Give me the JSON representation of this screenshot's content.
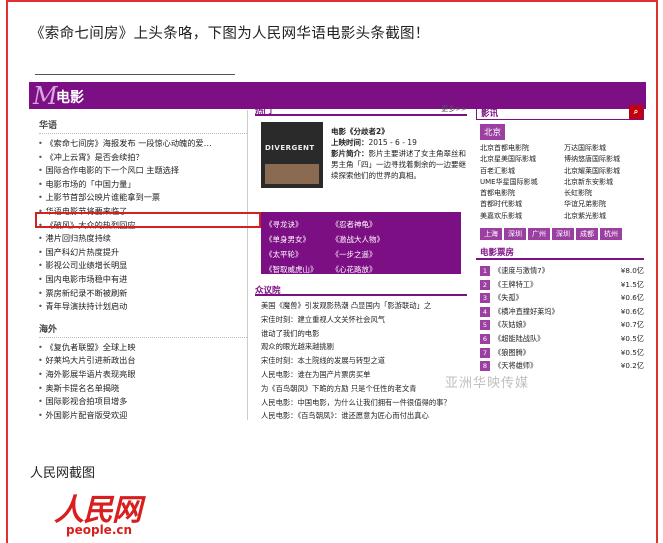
{
  "headline": "《索命七间房》上头条咯，下图为人民网华语电影头条截图！",
  "screenshot": {
    "section_logo_mark": "M",
    "section_title": "电影",
    "left": {
      "chinese_title": "华语",
      "chinese_items": [
        "《索命七间房》海报发布 一段惊心动魄的爱…",
        "《冲上云霄》是否会续拍？",
        "国际合作电影的下一个风口 主题选择",
        "电影市场的「中国力量」",
        "上影节首部公映片谁能拿到一票",
        "华语电影节将要来临了",
        "《破风》大众的热烈回应",
        "港片回归热度持续",
        "国产科幻片热度提升",
        "影视公司业绩增长明显",
        "国内电影市场稳中有进",
        "票房新纪录不断被刷新",
        "青年导演扶持计划启动"
      ],
      "overseas_title": "海外",
      "overseas_items": [
        "《复仇者联盟》全球上映",
        "好莱坞大片引进新政出台",
        "海外影展华语片表现亮眼",
        "奥斯卡提名名单揭晓",
        "国际影视合拍项目增多",
        "外国影片配音版受欢迎"
      ]
    },
    "middle": {
      "hot_label": "热门",
      "more_label": "更多>>",
      "poster_title": "DIVERGENT",
      "movie_title": "电影《分歧者2》",
      "release_label": "上映时间：",
      "release_date": "2015 - 6 - 19",
      "synopsis_label": "影片简介：",
      "synopsis": "影片主要讲述了女主角翠丝和男主角「四」一边寻找着剩余的一边要继续探索他们的世界的真相。",
      "tags": [
        "《寻龙诀》",
        "《忍者神龟》",
        "《单身男女》",
        "《激战大人物》",
        "《太平轮》",
        "《一步之遥》",
        "《智取威虎山》",
        "《心花路放》"
      ],
      "forum_title": "众议院",
      "forum_items": [
        "美国《魔兽》引发观影热潮 凸显国内「影游联动」之",
        "宋佳时刻：建立重视人文关怀社会风气",
        "谁动了我们的电影",
        "观众的眼光越来越挑剔",
        "宋佳时刻：本土院线的发展与转型之道",
        "人民电影：谁在为国产片票房买单",
        "为《百鸟朝凤》下跪的方励 只是个任性的老文青",
        "人民电影：中国电影，为什么让我们拥有一件很值得的事？",
        "人民电影：《百鸟朝凤》：谁还愿意为匠心而付出真心"
      ]
    },
    "right": {
      "header": "影讯",
      "search_icon_glyph": "⌕",
      "city": "北京",
      "cinemas": [
        "北京首都电影院",
        "万达国际影城",
        "北京星美国际影城",
        "博纳悠唐国际影城",
        "百老汇影城",
        "北京耀莱国际影城",
        "UME华星国际影城",
        "北京新东安影城",
        "首都电影院",
        "长虹影院",
        "首都时代影城",
        "华谊兄弟影院",
        "美嘉欢乐影城",
        "北京紫光影城"
      ],
      "cities": [
        "上海",
        "深圳",
        "广州",
        "深圳",
        "成都",
        "杭州"
      ],
      "box_office_title": "电影票房",
      "box_office": [
        {
          "rank": "1",
          "name": "《速度与激情7》",
          "price": "¥8.0亿"
        },
        {
          "rank": "2",
          "name": "《王牌特工》",
          "price": "¥1.5亿"
        },
        {
          "rank": "3",
          "name": "《失孤》",
          "price": "¥0.6亿"
        },
        {
          "rank": "4",
          "name": "《横冲直撞好莱坞》",
          "price": "¥0.6亿"
        },
        {
          "rank": "5",
          "name": "《灰姑娘》",
          "price": "¥0.7亿"
        },
        {
          "rank": "6",
          "name": "《超能陆战队》",
          "price": "¥0.5亿"
        },
        {
          "rank": "7",
          "name": "《狼图腾》",
          "price": "¥0.5亿"
        },
        {
          "rank": "8",
          "name": "《天将雄师》",
          "price": "¥0.2亿"
        }
      ]
    },
    "watermark": "亚洲华映传媒"
  },
  "caption": "人民网截图",
  "logo": {
    "chinese": "人民网",
    "english": "people.cn"
  },
  "colors": {
    "frame": "#e03030",
    "brand": "#7d0f84",
    "highlight": "#d42020"
  }
}
